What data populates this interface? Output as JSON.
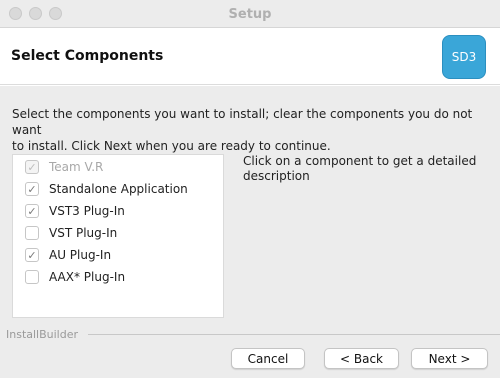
{
  "window": {
    "title": "Setup"
  },
  "header": {
    "title": "Select Components",
    "logo_text": "SD3",
    "logo_color": "#3aa6d8"
  },
  "intro": "Select the components you want to install; clear the components you do not want\nto install. Click Next when you are ready to continue.",
  "components": [
    {
      "label": "Team V.R",
      "checked": true,
      "enabled": false
    },
    {
      "label": "Standalone Application",
      "checked": true,
      "enabled": true
    },
    {
      "label": "VST3 Plug-In",
      "checked": true,
      "enabled": true
    },
    {
      "label": "VST Plug-In",
      "checked": false,
      "enabled": true
    },
    {
      "label": "AU Plug-In",
      "checked": true,
      "enabled": true
    },
    {
      "label": "AAX* Plug-In",
      "checked": false,
      "enabled": true
    }
  ],
  "description": "Click on a component to get a detailed description",
  "footer": {
    "brand": "InstallBuilder",
    "cancel_label": "Cancel",
    "back_label": "< Back",
    "next_label": "Next >"
  }
}
